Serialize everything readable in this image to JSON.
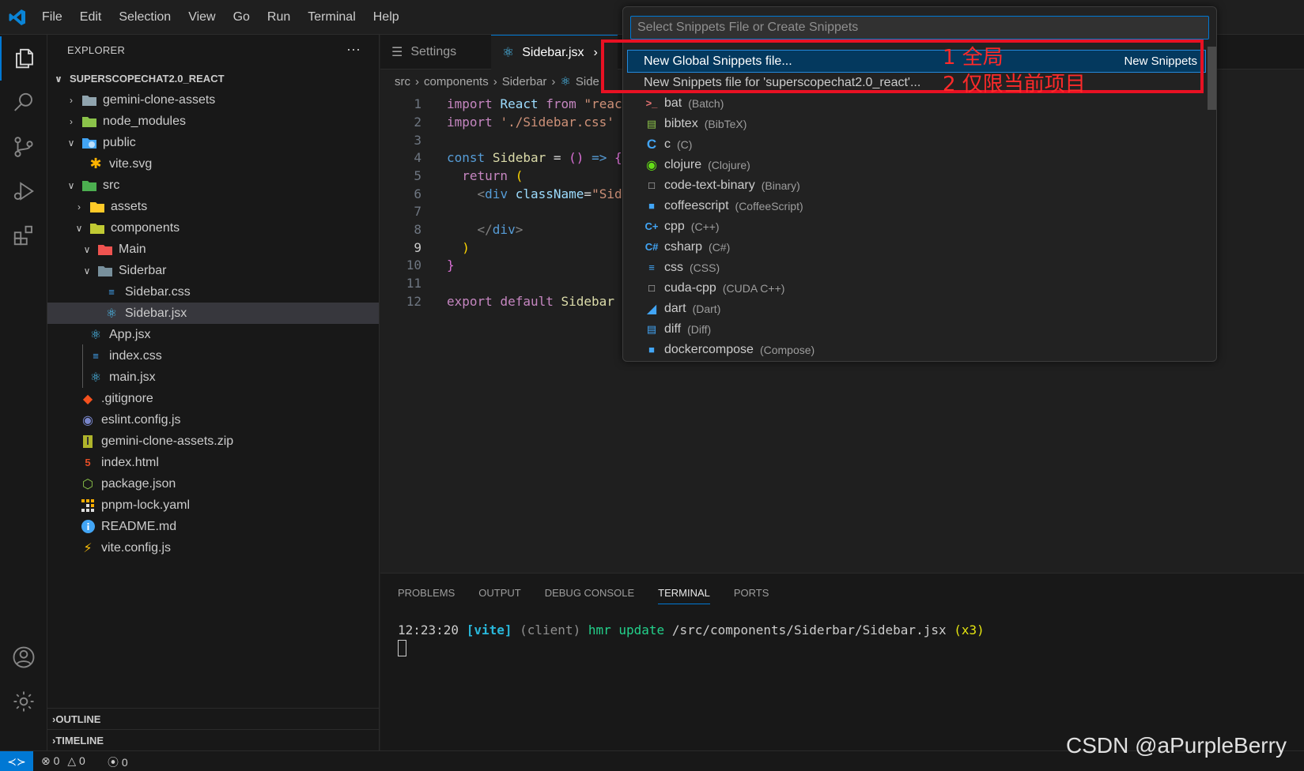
{
  "menu": [
    "File",
    "Edit",
    "Selection",
    "View",
    "Go",
    "Run",
    "Terminal",
    "Help"
  ],
  "sidebar": {
    "title": "EXPLORER",
    "more": "···",
    "root": "SUPERSCOPECHAT2.0_REACT",
    "items": [
      {
        "label": "gemini-clone-assets",
        "icon": "folder-icon"
      },
      {
        "label": "node_modules",
        "icon": "folder-node-icon"
      },
      {
        "label": "public",
        "icon": "folder-public-icon"
      },
      {
        "label": "vite.svg",
        "icon": "svg-file-icon"
      },
      {
        "label": "src",
        "icon": "folder-src-icon"
      },
      {
        "label": "assets",
        "icon": "folder-assets-icon"
      },
      {
        "label": "components",
        "icon": "folder-components-icon"
      },
      {
        "label": "Main",
        "icon": "folder-main-icon"
      },
      {
        "label": "Siderbar",
        "icon": "folder-open-icon"
      },
      {
        "label": "Sidebar.css",
        "icon": "css-file-icon"
      },
      {
        "label": "Sidebar.jsx",
        "icon": "react-file-icon"
      },
      {
        "label": "App.jsx",
        "icon": "react-file-icon"
      },
      {
        "label": "index.css",
        "icon": "css-file-icon"
      },
      {
        "label": "main.jsx",
        "icon": "react-file-icon"
      },
      {
        "label": ".gitignore",
        "icon": "git-file-icon"
      },
      {
        "label": "eslint.config.js",
        "icon": "eslint-file-icon"
      },
      {
        "label": "gemini-clone-assets.zip",
        "icon": "zip-file-icon"
      },
      {
        "label": "index.html",
        "icon": "html-file-icon"
      },
      {
        "label": "package.json",
        "icon": "node-file-icon"
      },
      {
        "label": "pnpm-lock.yaml",
        "icon": "pnpm-file-icon"
      },
      {
        "label": "README.md",
        "icon": "info-file-icon"
      },
      {
        "label": "vite.config.js",
        "icon": "vite-file-icon"
      }
    ],
    "outline": "OUTLINE",
    "timeline": "TIMELINE"
  },
  "tabs": [
    {
      "label": "Settings"
    },
    {
      "label": "Sidebar.jsx"
    }
  ],
  "breadcrumb": [
    "src",
    "components",
    "Siderbar",
    "Side"
  ],
  "code": {
    "line_numbers": [
      "1",
      "2",
      "3",
      "4",
      "5",
      "6",
      "7",
      "8",
      "9",
      "10",
      "11",
      "12"
    ],
    "current_line": "9",
    "l1": {
      "a": "import",
      "b": "React",
      "c": "from",
      "d": "\"reac"
    },
    "l2": {
      "a": "import",
      "b": "'./Sidebar.css'"
    },
    "l4": {
      "a": "const",
      "b": "Sidebar",
      "c": "=",
      "d": "()",
      "e": "=>",
      "f": "{"
    },
    "l5": {
      "a": "return",
      "b": "("
    },
    "l6": {
      "a": "<",
      "b": "div",
      "c": "className",
      "d": "=",
      "e": "\"Sid"
    },
    "l8": {
      "a": "</",
      "b": "div",
      "c": ">"
    },
    "l9": {
      "a": ")"
    },
    "l10": {
      "a": "}"
    },
    "l12": {
      "a": "export",
      "b": "default",
      "c": "Sidebar"
    }
  },
  "panel": {
    "tabs": [
      "PROBLEMS",
      "OUTPUT",
      "DEBUG CONSOLE",
      "TERMINAL",
      "PORTS"
    ],
    "active_tab": "TERMINAL",
    "terminal": {
      "time": "12:23:20",
      "tag": "[vite]",
      "client": "(client)",
      "event": "hmr update",
      "path": "/src/components/Siderbar/Sidebar.jsx",
      "count": "(x3)"
    }
  },
  "status": {
    "errors": "0",
    "warnings": "0",
    "ports": "0"
  },
  "quickpick": {
    "placeholder": "Select Snippets File or Create Snippets",
    "items": [
      {
        "label": "New Global Snippets file...",
        "right": "New Snippets"
      },
      {
        "label": "New Snippets file for 'superscopechat2.0_react'..."
      }
    ],
    "languages": [
      {
        "name": "bat",
        "desc": "(Batch)",
        "icon": "bat-icon"
      },
      {
        "name": "bibtex",
        "desc": "(BibTeX)",
        "icon": "bibtex-icon"
      },
      {
        "name": "c",
        "desc": "(C)",
        "icon": "c-icon"
      },
      {
        "name": "clojure",
        "desc": "(Clojure)",
        "icon": "clojure-icon"
      },
      {
        "name": "code-text-binary",
        "desc": "(Binary)",
        "icon": "file-icon"
      },
      {
        "name": "coffeescript",
        "desc": "(CoffeeScript)",
        "icon": "coffee-icon"
      },
      {
        "name": "cpp",
        "desc": "(C++)",
        "icon": "cpp-icon"
      },
      {
        "name": "csharp",
        "desc": "(C#)",
        "icon": "csharp-icon"
      },
      {
        "name": "css",
        "desc": "(CSS)",
        "icon": "css-icon"
      },
      {
        "name": "cuda-cpp",
        "desc": "(CUDA C++)",
        "icon": "file-icon"
      },
      {
        "name": "dart",
        "desc": "(Dart)",
        "icon": "dart-icon"
      },
      {
        "name": "diff",
        "desc": "(Diff)",
        "icon": "diff-icon"
      },
      {
        "name": "dockercompose",
        "desc": "(Compose)",
        "icon": "docker-icon"
      }
    ]
  },
  "annotations": {
    "first": "1 全局",
    "second": "2 仅限当前项目"
  },
  "watermark": "CSDN @aPurpleBerry",
  "colors": {
    "accent": "#0078d4",
    "annotation": "#e81123",
    "selection": "#04395e"
  }
}
